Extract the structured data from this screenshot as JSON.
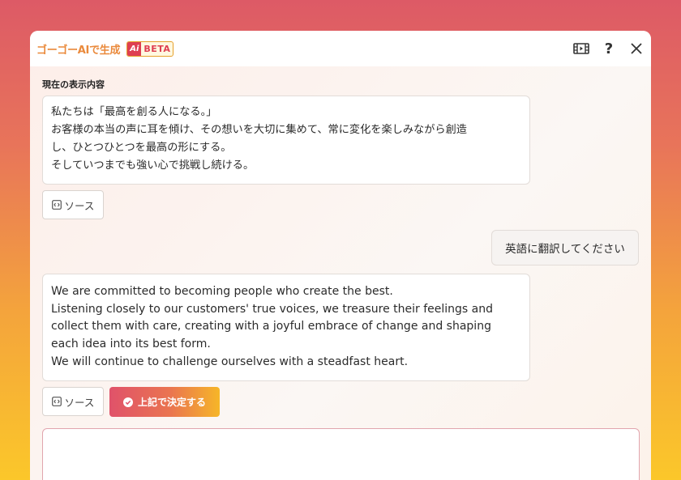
{
  "header": {
    "brand": "ゴーゴーAIで生成",
    "beta_ai": "Ai",
    "beta_label": "BETA"
  },
  "icons": {
    "video": "video-icon",
    "help": "?",
    "close": "close-icon",
    "source": "code-icon",
    "check": "check-circle-icon"
  },
  "current": {
    "label": "現在の表示内容",
    "lines": [
      "私たちは「最高を創る人になる。」",
      "お客様の本当の声に耳を傾け、その想いを大切に集めて、常に変化を楽しみながら創造",
      "し、ひとつひとつを最高の形にする。",
      "そしていつまでも強い心で挑戦し続ける。"
    ],
    "source_label": "ソース"
  },
  "user_message": "英語に翻訳してください",
  "response": {
    "lines": [
      "We are committed to becoming people who create the best.",
      "Listening closely to our customers' true voices, we treasure their feelings and",
      "collect them with care, creating with a joyful embrace of change and shaping",
      "each idea into its best form.",
      "We will continue to challenge ourselves with a steadfast heart."
    ],
    "source_label": "ソース",
    "decide_label": "上記で決定する"
  },
  "input": {
    "value": ""
  },
  "colors": {
    "brand": "#ea8a3c",
    "accent_red": "#de3f52",
    "accent_yellow": "#f6b628"
  }
}
